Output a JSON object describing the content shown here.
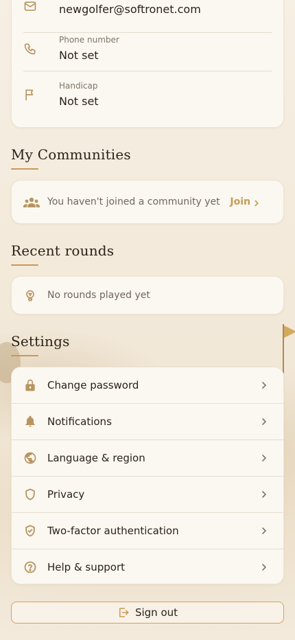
{
  "profile": {
    "email_value": "newgolfer@softronet.com",
    "phone_label": "Phone number",
    "phone_value": "Not set",
    "handicap_label": "Handicap",
    "handicap_value": "Not set"
  },
  "communities": {
    "title": "My Communities",
    "empty_text": "You haven't joined a community yet",
    "join_label": "Join"
  },
  "rounds": {
    "title": "Recent rounds",
    "empty_text": "No rounds played yet"
  },
  "settings": {
    "title": "Settings",
    "items": [
      {
        "label": "Change password",
        "icon": "lock-icon"
      },
      {
        "label": "Notifications",
        "icon": "bell-icon"
      },
      {
        "label": "Language & region",
        "icon": "globe-icon"
      },
      {
        "label": "Privacy",
        "icon": "shield-icon"
      },
      {
        "label": "Two-factor authentication",
        "icon": "shield-check-icon"
      },
      {
        "label": "Help & support",
        "icon": "help-circle-icon"
      }
    ]
  },
  "signout": {
    "label": "Sign out"
  },
  "colors": {
    "accent": "#c79a55",
    "card": "#fbf8f2",
    "background": "#f5ede0",
    "text": "#2a2218"
  }
}
